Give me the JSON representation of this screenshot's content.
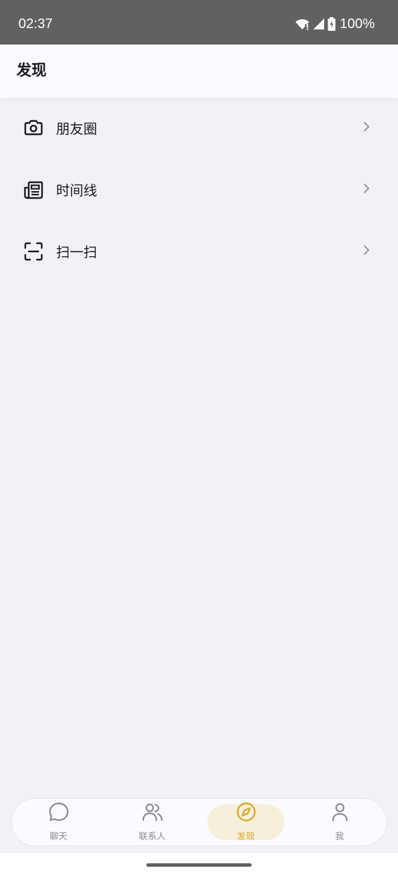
{
  "status_bar": {
    "time": "02:37",
    "battery": "100%",
    "icons": [
      "wifi-icon",
      "signal-icon",
      "battery-icon"
    ]
  },
  "header": {
    "title": "发现"
  },
  "menu": {
    "items": [
      {
        "label": "朋友圈",
        "icon": "camera-icon"
      },
      {
        "label": "时间线",
        "icon": "newspaper-icon"
      },
      {
        "label": "扫一扫",
        "icon": "scan-icon"
      }
    ]
  },
  "nav": {
    "items": [
      {
        "label": "聊天",
        "icon": "chat-icon",
        "active": false
      },
      {
        "label": "联系人",
        "icon": "contacts-icon",
        "active": false
      },
      {
        "label": "发现",
        "icon": "compass-icon",
        "active": true
      },
      {
        "label": "我",
        "icon": "profile-icon",
        "active": false
      }
    ]
  },
  "colors": {
    "accent": "#d9a72a",
    "accent_bg": "#f6efdc",
    "page_bg": "#f2f1f6",
    "status_bar_bg": "#616161"
  }
}
